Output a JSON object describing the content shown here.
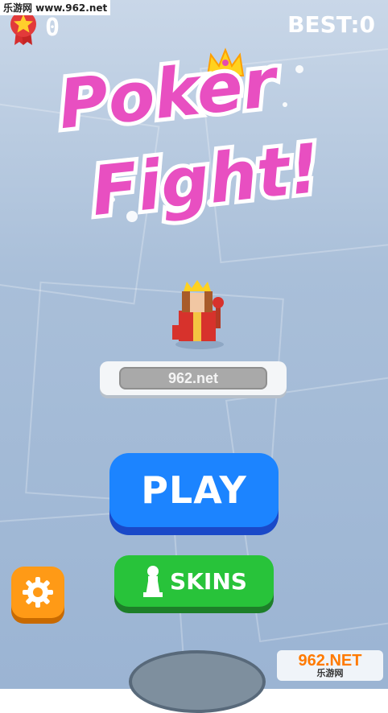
{
  "watermark_top": "乐游网 www.962.net",
  "hud": {
    "score": "0",
    "best": "BEST:0"
  },
  "title": {
    "line1": "Poker",
    "line2": "Fight!"
  },
  "player": {
    "name": "962.net"
  },
  "buttons": {
    "play": "PLAY",
    "skins": "SKINS"
  },
  "watermark_bottom": {
    "brand": "962.NET",
    "name": "乐游网"
  },
  "colors": {
    "title_pink": "#e84fc1",
    "play_blue": "#1c84ff",
    "skins_green": "#28c33a",
    "settings_orange": "#ff9a16"
  },
  "icons": [
    "medal-star-icon",
    "crown-icon",
    "pawn-icon",
    "gear-icon"
  ]
}
